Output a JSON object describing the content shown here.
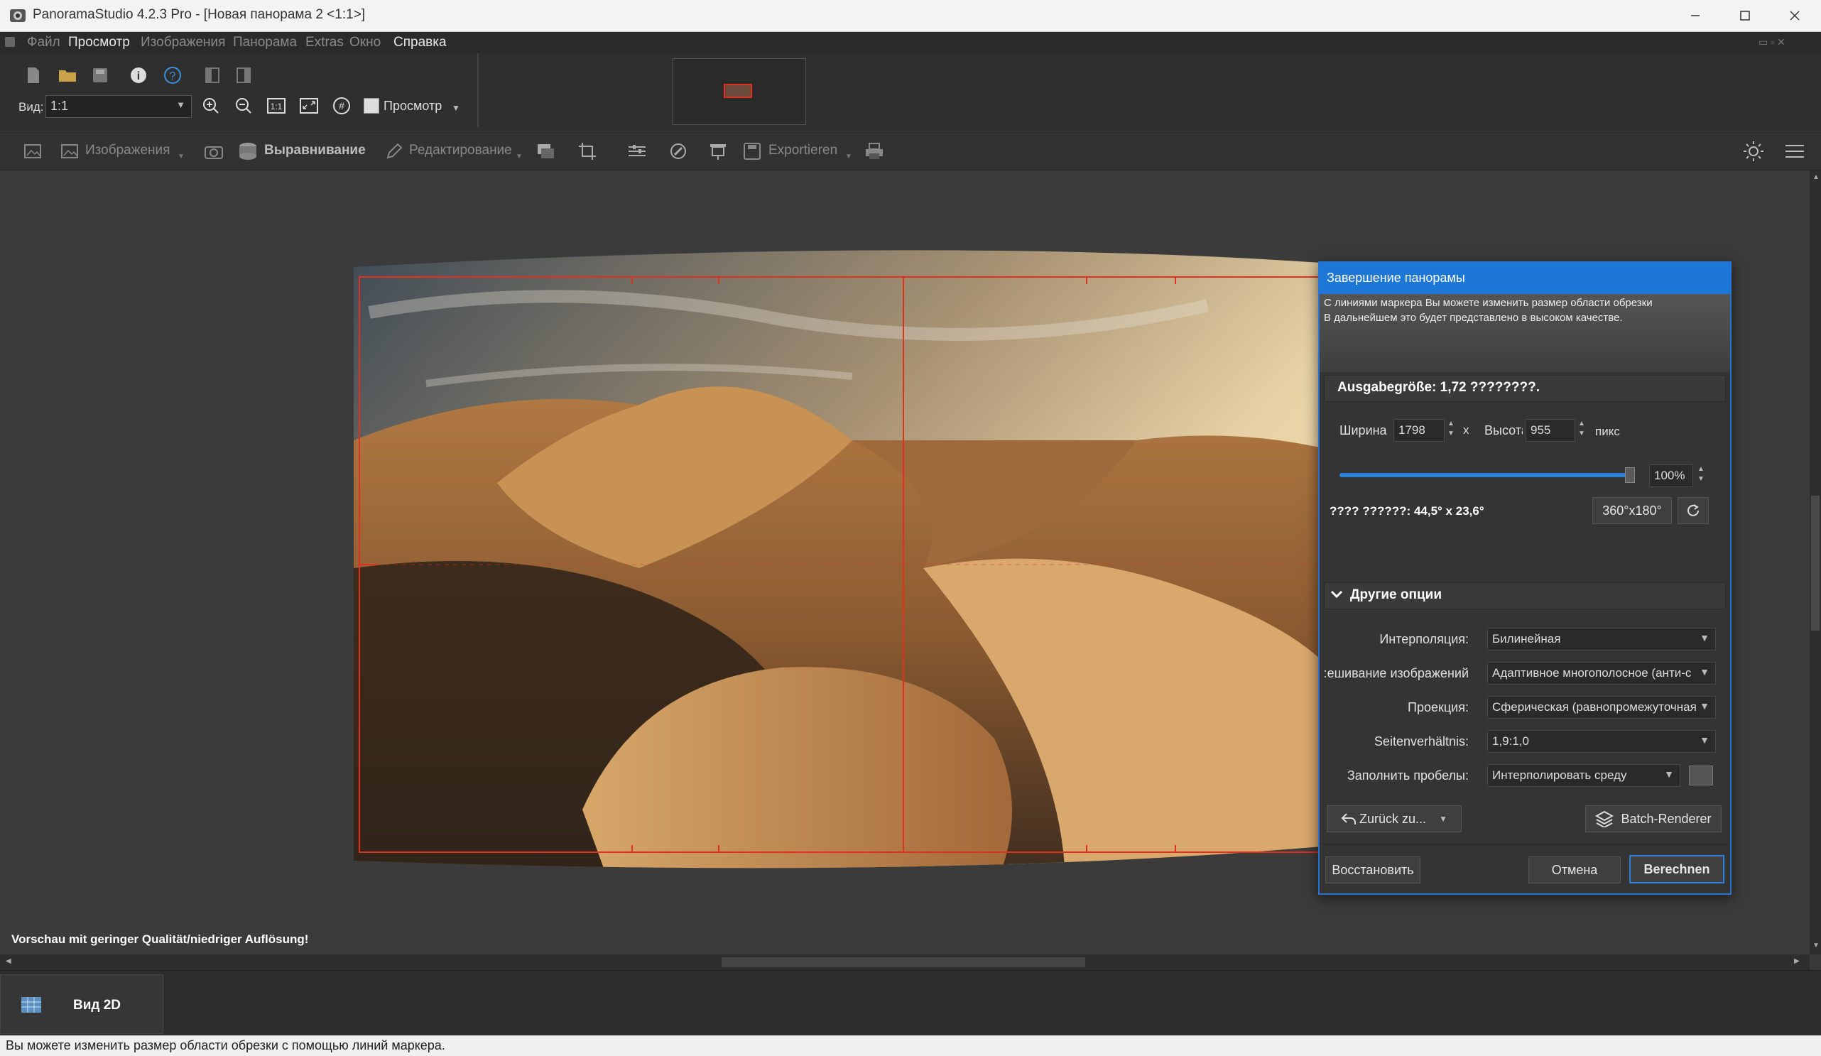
{
  "window": {
    "title": "PanoramaStudio 4.2.3 Pro - [Новая панорама 2 <1:1>]"
  },
  "menu": {
    "items": [
      "Файл",
      "Просмотр",
      "Изображения",
      "Панорама",
      "Extras",
      "Окно",
      "Справка"
    ]
  },
  "toolbar": {
    "view_label": "Вид:",
    "view_value": "1:1",
    "preview_label": "Просмотр"
  },
  "toolbar2": {
    "images_label": "Изображения",
    "align_label": "Выравнивание",
    "edit_label": "Редактирование",
    "export_label": "Exportieren"
  },
  "canvas": {
    "preview_notice": "Vorschau mit geringer Qualität/niedriger Auflösung!"
  },
  "bottom": {
    "tab_label": "Вид 2D"
  },
  "statusbar": {
    "text": "Вы можете изменить размер области обрезки с помощью линий маркера."
  },
  "dialog": {
    "title": "Завершение панорамы",
    "info_line1": "С линиями маркера Вы можете изменить размер области обрезки",
    "info_line2": "В дальнейшем это будет представлено в высоком качестве.",
    "output_size": "Ausgabegröße: 1,72 ????????.",
    "width_label": "Ширина",
    "width_value": "1798",
    "times": "x",
    "height_label": "Высота",
    "height_value": "955",
    "unit": "пикс",
    "scale_percent": "100%",
    "scale_fraction": 0.98,
    "fov_text": "???? ??????: 44,5° x 23,6°",
    "fov_button": "360°x180°",
    "other_options": "Другие опции",
    "options": [
      {
        "label": "Интерполяция:",
        "value": "Билинейная"
      },
      {
        "label": "ешивание изображений:",
        "value": "Адаптивное многополосное (анти-с"
      },
      {
        "label": "Проекция:",
        "value": "Сферическая (равнопромежуточная"
      },
      {
        "label": "Seitenverhältnis:",
        "value": "1,9:1,0"
      },
      {
        "label": "Заполнить пробелы:",
        "value": "Интерполировать среду"
      }
    ],
    "back_button": "Zurück zu...",
    "batch_button": "Batch-Renderer",
    "restore_button": "Восстановить",
    "cancel_button": "Отмена",
    "compute_button": "Berechnen"
  },
  "colors": {
    "accent": "#1c77d6",
    "crop_line": "#e0301e",
    "slider": "#2d7fd8"
  }
}
